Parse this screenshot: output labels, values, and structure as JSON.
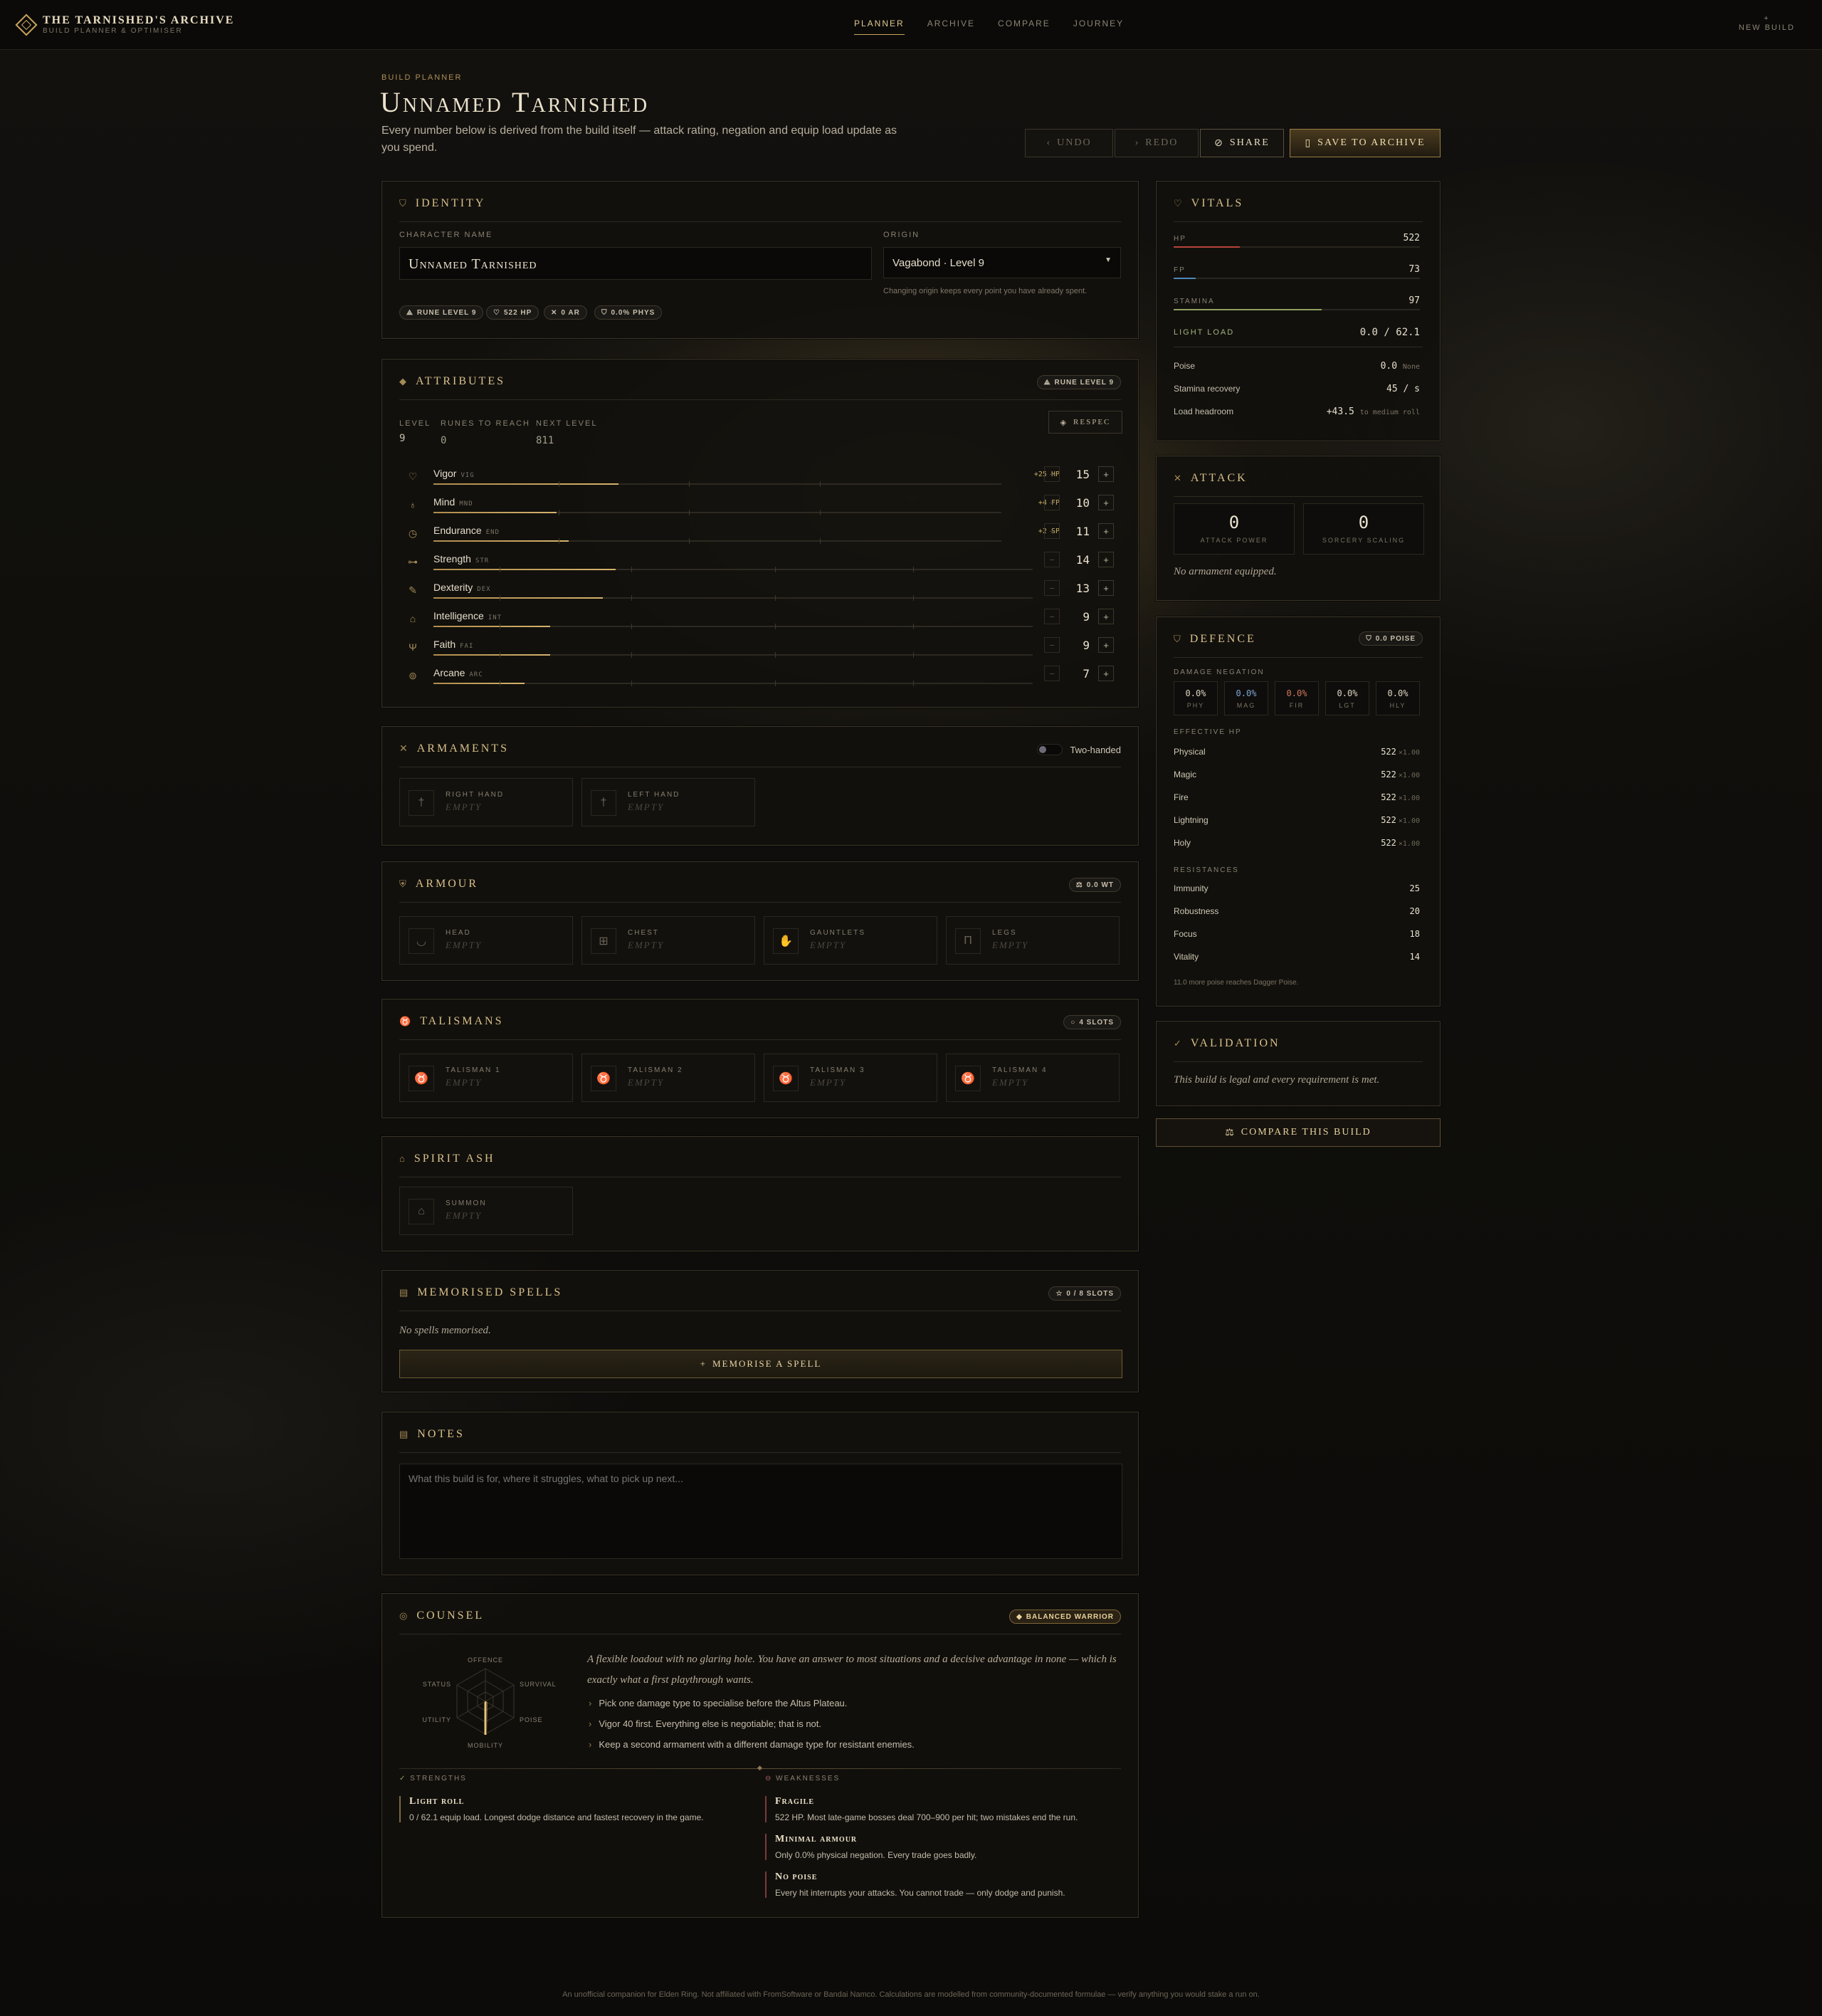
{
  "app": {
    "title": "THE TARNISHED'S ARCHIVE",
    "subtitle": "BUILD PLANNER & OPTIMISER",
    "new_build_icon": "+",
    "new_build": "NEW BUILD"
  },
  "nav": [
    {
      "label": "PLANNER",
      "active": true
    },
    {
      "label": "ARCHIVE"
    },
    {
      "label": "COMPARE"
    },
    {
      "label": "JOURNEY"
    }
  ],
  "page": {
    "eyebrow": "BUILD PLANNER",
    "title": "Unnamed Tarnished",
    "lead_1": "Every number below is derived from the build itself — attack rating, negation and equip load update as",
    "lead_2": "you spend."
  },
  "actions": {
    "undo": "UNDO",
    "redo": "REDO",
    "share": "SHARE",
    "save": "SAVE TO ARCHIVE"
  },
  "identity": {
    "title": "IDENTITY",
    "name_label": "CHARACTER NAME",
    "name_value": "Unnamed Tarnished",
    "origin_label": "ORIGIN",
    "origin_value": "Vagabond · Level 9",
    "origin_hint": "Changing origin keeps every point you have already spent.",
    "chips": [
      "RUNE LEVEL 9",
      "522 HP",
      "0 AR",
      "0.0% PHYS"
    ]
  },
  "attributes": {
    "title": "ATTRIBUTES",
    "chip": "RUNE LEVEL 9",
    "level_label": "LEVEL",
    "level": "9",
    "runes_label": "RUNES TO REACH",
    "runes": "0",
    "next_label": "NEXT LEVEL",
    "next": "811",
    "respec": "RESPEC",
    "rows": [
      {
        "name": "Vigor",
        "abbr": "VIG",
        "bonus": "+25 HP",
        "value": "15",
        "fill": 0.15,
        "icon": "heart-icon"
      },
      {
        "name": "Mind",
        "abbr": "MND",
        "bonus": "+4 FP",
        "value": "10",
        "fill": 0.1,
        "icon": "droplet-icon"
      },
      {
        "name": "Endurance",
        "abbr": "END",
        "bonus": "+2 SP",
        "value": "11",
        "fill": 0.11,
        "icon": "clock-icon"
      },
      {
        "name": "Strength",
        "abbr": "STR",
        "bonus": "",
        "value": "14",
        "fill": 0.14,
        "icon": "dumbbell-icon"
      },
      {
        "name": "Dexterity",
        "abbr": "DEX",
        "bonus": "",
        "value": "13",
        "fill": 0.13,
        "icon": "feather-icon"
      },
      {
        "name": "Intelligence",
        "abbr": "INT",
        "bonus": "",
        "value": "9",
        "fill": 0.09,
        "icon": "lamp-icon"
      },
      {
        "name": "Faith",
        "abbr": "FAI",
        "bonus": "",
        "value": "9",
        "fill": 0.09,
        "icon": "chalice-icon"
      },
      {
        "name": "Arcane",
        "abbr": "ARC",
        "bonus": "",
        "value": "7",
        "fill": 0.07,
        "icon": "sigil-icon"
      }
    ]
  },
  "armaments": {
    "title": "ARMAMENTS",
    "toggle_label": "Two-handed",
    "slots": [
      {
        "label": "RIGHT HAND",
        "value": "EMPTY"
      },
      {
        "label": "LEFT HAND",
        "value": "EMPTY"
      }
    ]
  },
  "armour": {
    "title": "ARMOUR",
    "chip": "0.0 WT",
    "slots": [
      {
        "label": "HEAD",
        "value": "EMPTY"
      },
      {
        "label": "CHEST",
        "value": "EMPTY"
      },
      {
        "label": "GAUNTLETS",
        "value": "EMPTY"
      },
      {
        "label": "LEGS",
        "value": "EMPTY"
      }
    ]
  },
  "talismans": {
    "title": "TALISMANS",
    "chip": "4 SLOTS",
    "slots": [
      {
        "label": "TALISMAN 1",
        "value": "EMPTY"
      },
      {
        "label": "TALISMAN 2",
        "value": "EMPTY"
      },
      {
        "label": "TALISMAN 3",
        "value": "EMPTY"
      },
      {
        "label": "TALISMAN 4",
        "value": "EMPTY"
      }
    ]
  },
  "spirit": {
    "title": "SPIRIT ASH",
    "slot": {
      "label": "SUMMON",
      "value": "EMPTY"
    }
  },
  "spells": {
    "title": "MEMORISED SPELLS",
    "chip": "0 / 8 SLOTS",
    "empty": "No spells memorised.",
    "button": "MEMORISE A SPELL"
  },
  "notes": {
    "title": "NOTES",
    "placeholder": "What this build is for, where it struggles, what to pick up next..."
  },
  "counsel": {
    "title": "COUNSEL",
    "chip": "BALANCED WARRIOR",
    "radar_labels": {
      "offence": "OFFENCE",
      "survival": "SURVIVAL",
      "poise": "POISE",
      "mobility": "MOBILITY",
      "utility": "UTILITY",
      "status": "STATUS"
    },
    "summary_1": "A flexible loadout with no glaring hole. You have an answer to most situations and a decisive advantage in none — which is",
    "summary_2": "exactly what a first playthrough wants.",
    "tips": [
      "Pick one damage type to specialise before the Altus Plateau.",
      "Vigor 40 first. Everything else is negotiable; that is not.",
      "Keep a second armament with a different damage type for resistant enemies."
    ],
    "strengths_label": "STRENGTHS",
    "weaknesses_label": "WEAKNESSES",
    "strengths": [
      {
        "title": "Light roll",
        "desc": "0 / 62.1 equip load. Longest dodge distance and fastest recovery in the game."
      }
    ],
    "weaknesses": [
      {
        "title": "Fragile",
        "desc": "522 HP. Most late-game bosses deal 700–900 per hit; two mistakes end the run."
      },
      {
        "title": "Minimal armour",
        "desc": "Only 0.0% physical negation. Every trade goes badly."
      },
      {
        "title": "No poise",
        "desc": "Every hit interrupts your attacks. You cannot trade — only dodge and punish."
      }
    ]
  },
  "vitals": {
    "title": "VITALS",
    "bars": [
      {
        "label": "HP",
        "value": "522",
        "fill": 0.27,
        "color": "#b8443c"
      },
      {
        "label": "FP",
        "value": "73",
        "fill": 0.09,
        "color": "#4f86b8"
      },
      {
        "label": "STAMINA",
        "value": "97",
        "fill": 0.6,
        "color": "#8fa15e"
      }
    ],
    "load_label": "LIGHT LOAD",
    "load_value": "0.0 / 62.1",
    "rows": [
      {
        "label": "Poise",
        "value": "0.0",
        "suffix": "None"
      },
      {
        "label": "Stamina recovery",
        "value": "45 / s",
        "suffix": ""
      },
      {
        "label": "Load headroom",
        "value": "+43.5",
        "suffix": "to medium roll"
      }
    ]
  },
  "attack": {
    "title": "ATTACK",
    "ap_value": "0",
    "ap_label": "ATTACK POWER",
    "ss_value": "0",
    "ss_label": "SORCERY SCALING",
    "empty": "No armament equipped."
  },
  "defence": {
    "title": "DEFENCE",
    "chip": "0.0 POISE",
    "neg_label": "DAMAGE NEGATION",
    "neg": [
      {
        "k": "PHY",
        "v": "0.0%",
        "color": "#ddd5c2"
      },
      {
        "k": "MAG",
        "v": "0.0%",
        "color": "#7fa6d6"
      },
      {
        "k": "FIR",
        "v": "0.0%",
        "color": "#d0765a"
      },
      {
        "k": "LGT",
        "v": "0.0%",
        "color": "#ddd5c2"
      },
      {
        "k": "HLY",
        "v": "0.0%",
        "color": "#ddd5c2"
      }
    ],
    "ehp_label": "EFFECTIVE HP",
    "ehp": [
      {
        "label": "Physical",
        "value": "522",
        "mult": "×1.00"
      },
      {
        "label": "Magic",
        "value": "522",
        "mult": "×1.00"
      },
      {
        "label": "Fire",
        "value": "522",
        "mult": "×1.00"
      },
      {
        "label": "Lightning",
        "value": "522",
        "mult": "×1.00"
      },
      {
        "label": "Holy",
        "value": "522",
        "mult": "×1.00"
      }
    ],
    "res_label": "RESISTANCES",
    "res": [
      {
        "label": "Immunity",
        "value": "25"
      },
      {
        "label": "Robustness",
        "value": "20"
      },
      {
        "label": "Focus",
        "value": "18"
      },
      {
        "label": "Vitality",
        "value": "14"
      }
    ],
    "note": "11.0 more poise reaches Dagger Poise."
  },
  "validation": {
    "title": "VALIDATION",
    "text": "This build is legal and every requirement is met."
  },
  "compare_button": "COMPARE THIS BUILD",
  "footer": "An unofficial companion for Elden Ring. Not affiliated with FromSoftware or Bandai Namco. Calculations are modelled from community-documented formulae — verify anything you would stake a run on."
}
